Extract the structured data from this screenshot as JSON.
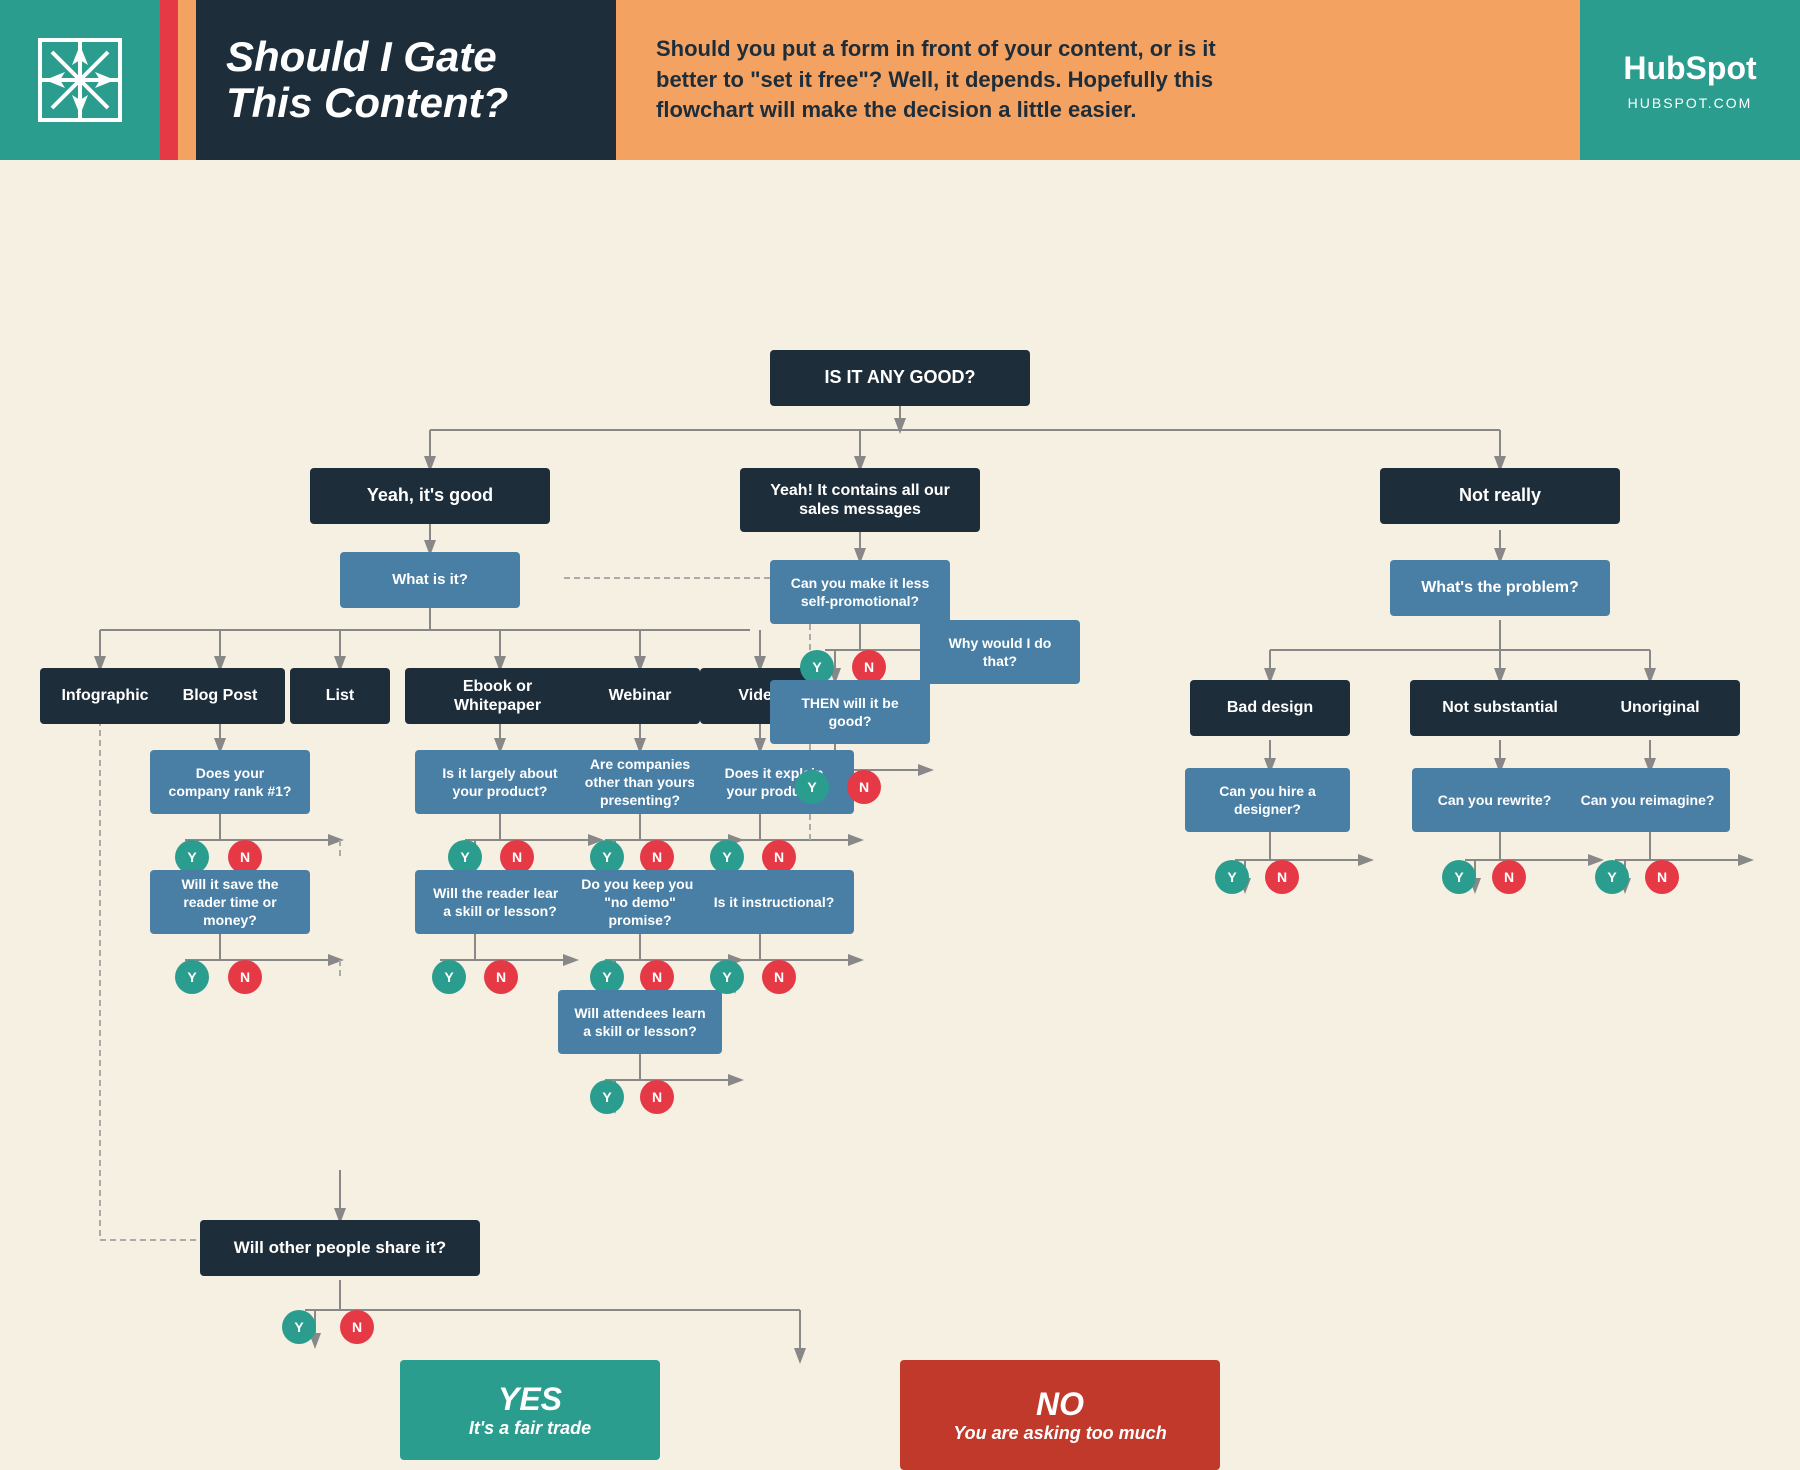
{
  "header": {
    "title": "Should I Gate\nThis Content?",
    "description": "Should you put a form in front of your content, or is it better to \"set it free\"? Well, it depends. Hopefully this flowchart will make the decision a little easier.",
    "hubspot_logo": "HubSpot",
    "hubspot_url": "HUBSPOT.COM"
  },
  "flowchart": {
    "start_node": "IS IT ANY GOOD?",
    "nodes": {
      "start": "IS IT ANY GOOD?",
      "yeah_good": "Yeah, it's good",
      "what_is_it": "What is it?",
      "yeah_sales": "Yeah! It contains all our sales messages",
      "not_really": "Not really",
      "infographic": "Infographic",
      "blog_post": "Blog Post",
      "list": "List",
      "ebook": "Ebook or Whitepaper",
      "webinar": "Webinar",
      "video": "Video",
      "company_rank": "Does your company rank #1?",
      "save_reader": "Will it save the reader time or money?",
      "largely_about": "Is it largely about your product?",
      "reader_learn": "Will the reader learn a skill or lesson?",
      "companies_other": "Are companies other than yours presenting?",
      "keep_no_demo": "Do you keep your \"no demo\" promise?",
      "attendees_learn": "Will attendees learn a skill or lesson?",
      "explain_product": "Does it explain your product?",
      "is_instructional": "Is it instructional?",
      "less_promo": "Can you make it less self-promotional?",
      "why_would": "Why would I do that?",
      "then_good": "THEN will it be good?",
      "whats_problem": "What's the problem?",
      "bad_design": "Bad design",
      "not_substantial": "Not substantial",
      "unoriginal": "Unoriginal",
      "hire_designer": "Can you hire a designer?",
      "can_rewrite": "Can you rewrite?",
      "can_reimagine": "Can you reimagine?",
      "will_share": "Will other people share it?",
      "result_yes": "YES\nIt's a fair trade",
      "result_no": "NO\nYou are asking too much"
    },
    "yn_labels": {
      "y": "Y",
      "n": "N"
    }
  }
}
